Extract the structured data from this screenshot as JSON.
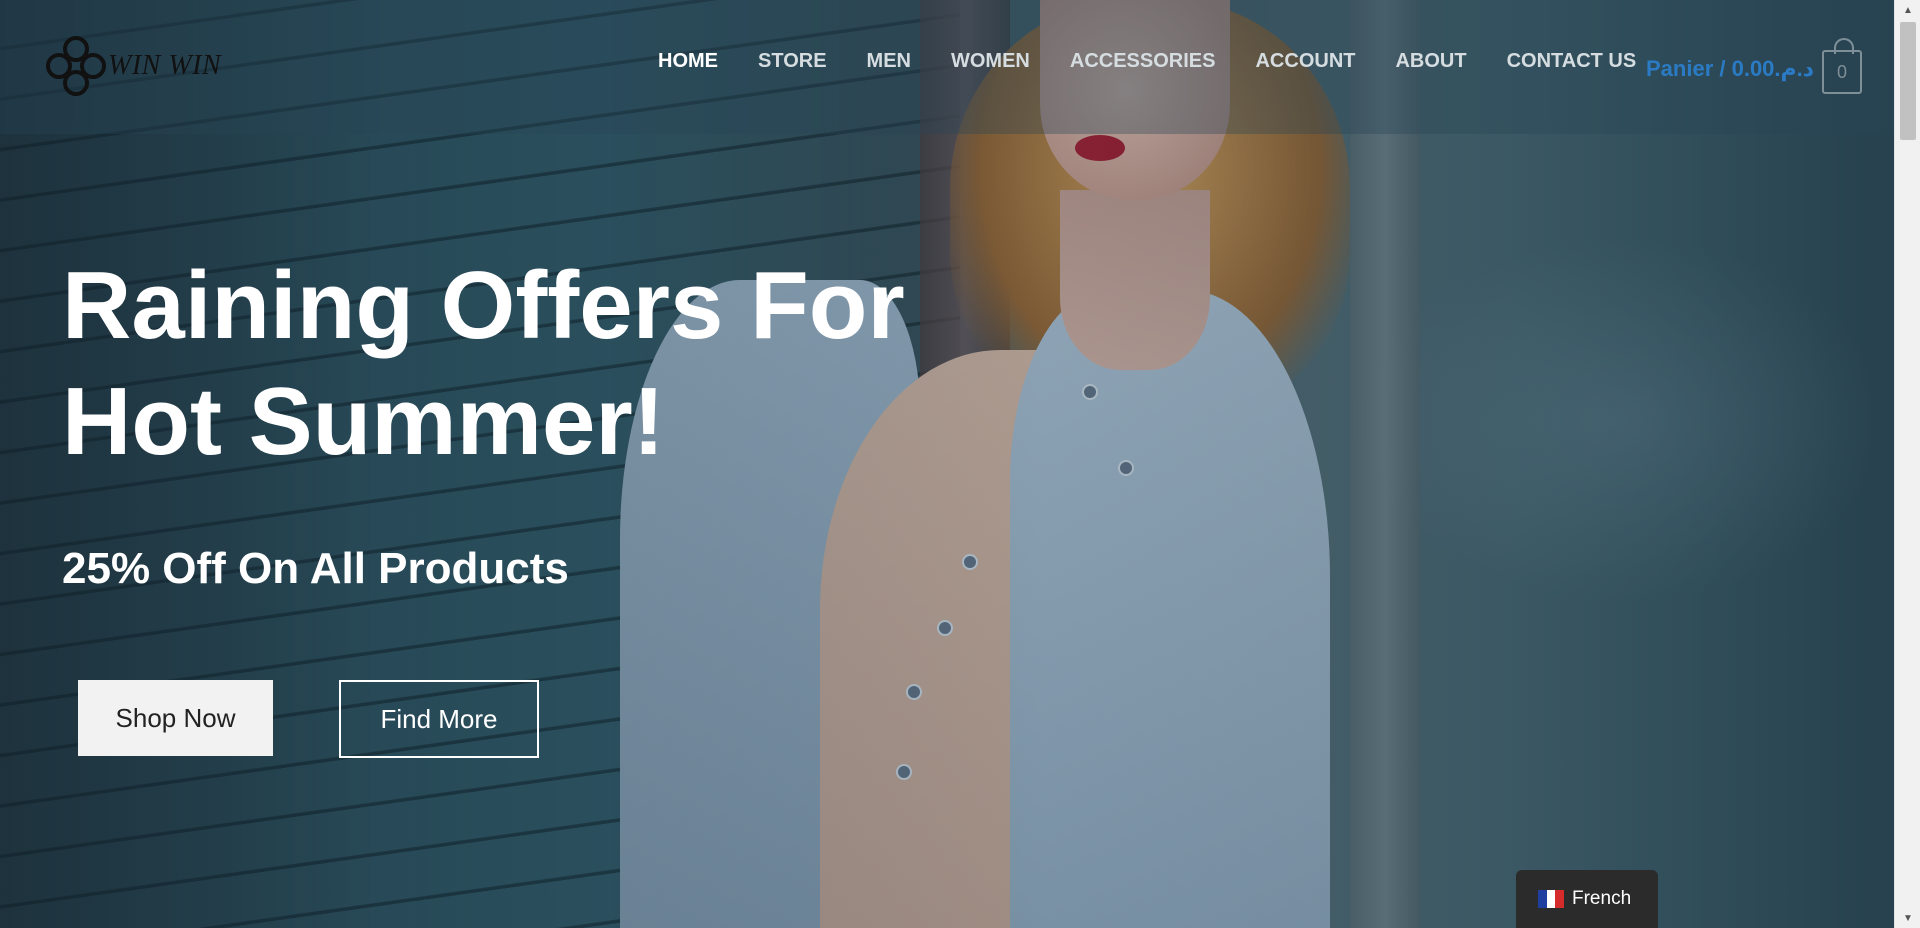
{
  "logo": {
    "text": "WIN WIN"
  },
  "nav": {
    "items": [
      {
        "label": "HOME",
        "active": true
      },
      {
        "label": "STORE",
        "active": false
      },
      {
        "label": "MEN",
        "active": false
      },
      {
        "label": "WOMEN",
        "active": false
      },
      {
        "label": "ACCESSORIES",
        "active": false
      },
      {
        "label": "ACCOUNT",
        "active": false
      },
      {
        "label": "ABOUT",
        "active": false
      },
      {
        "label": "CONTACT US",
        "active": false
      }
    ]
  },
  "cart": {
    "label": "Panier / 0.00.د.م",
    "count": "0",
    "icon": "shopping-bag-icon",
    "color": "#2b7bc4"
  },
  "hero": {
    "headline_line1": "Raining Offers For",
    "headline_line2": "Hot Summer!",
    "subline": "25% Off On All Products",
    "shop_button": "Shop Now",
    "find_button": "Find More"
  },
  "language": {
    "label": "French",
    "flag_icon": "france-flag-icon",
    "flag_colors": [
      "#1f3fa0",
      "#ffffff",
      "#d52b2b"
    ]
  },
  "scrollbar": {
    "up_icon": "scroll-up-arrow-icon",
    "down_icon": "scroll-down-arrow-icon"
  }
}
